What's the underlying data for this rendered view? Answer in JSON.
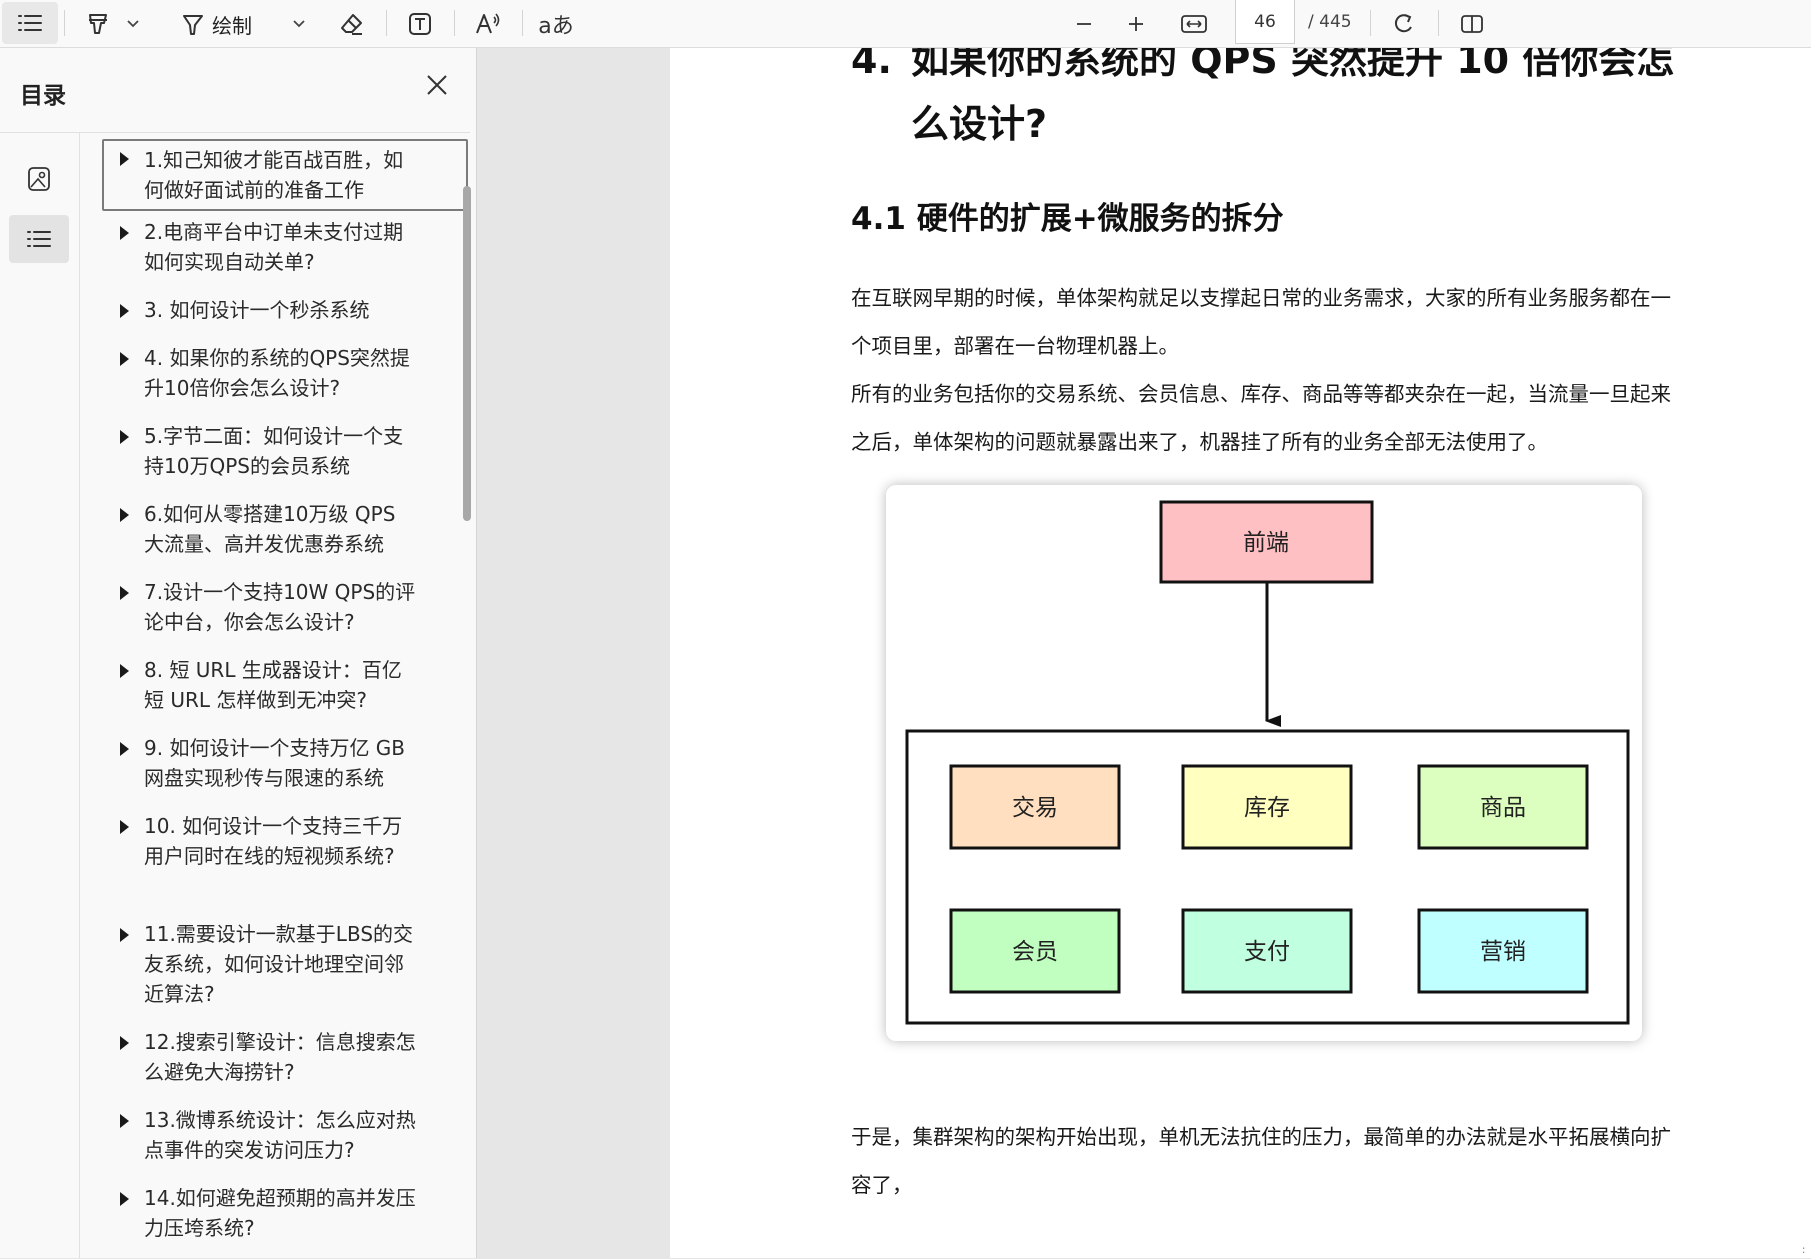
{
  "toolbar": {
    "draw_label": "绘制",
    "page_current": "46",
    "page_total": "/ 445"
  },
  "sidebar": {
    "title": "目录",
    "items": [
      "1.知己知彼才能百战百胜，如何做好面试前的准备工作",
      "2.电商平台中订单未支付过期如何实现自动关单?",
      "3. 如何设计一个秒杀系统",
      "4. 如果你的系统的QPS突然提升10倍你会怎么设计?",
      "5.字节二面：如何设计一个支持10万QPS的会员系统",
      "6.如何从零搭建10万级 QPS 大流量、高并发优惠券系统",
      "7.设计一个支持10W QPS的评论中台，你会怎么设计?",
      "8. 短 URL 生成器设计：百亿短 URL 怎样做到无冲突?",
      "9. 如何设计一个支持万亿 GB 网盘实现秒传与限速的系统",
      "10. 如何设计一个支持三千万用户同时在线的短视频系统?",
      "11.需要设计一款基于LBS的交友系统，如何设计地理空间邻近算法?",
      "12.搜索引擎设计：信息搜索怎么避免大海捞针?",
      "13.微博系统设计：怎么应对热点事件的突发访问压力?",
      "14.如何避免超预期的高并发压力压垮系统?"
    ]
  },
  "doc": {
    "h1_num": "4.",
    "h1_text": "如果你的系统的 QPS 突然提升 10 倍你会怎么设计?",
    "h2": "4.1  硬件的扩展+微服务的拆分",
    "para1": "在互联网早期的时候，单体架构就足以支撑起日常的业务需求，大家的所有业务服务都在一个项目里，部署在一台物理机器上。",
    "para2": "所有的业务包括你的交易系统、会员信息、库存、商品等等都夹杂在一起，当流量一旦起来之后，单体架构的问题就暴露出来了，机器挂了所有的业务全部无法使用了。",
    "para3": "于是，集群架构的架构开始出现，单机无法抗住的压力，最简单的办法就是水平拓展横向扩容了，"
  },
  "diagram": {
    "top": {
      "label": "前端",
      "color": "#ffc0c4"
    },
    "modules": [
      {
        "label": "交易",
        "color": "#ffdfbf"
      },
      {
        "label": "库存",
        "color": "#ffffc0"
      },
      {
        "label": "商品",
        "color": "#dcffbf"
      },
      {
        "label": "会员",
        "color": "#c1ffc1"
      },
      {
        "label": "支付",
        "color": "#c0ffe0"
      },
      {
        "label": "营销",
        "color": "#c0ffff"
      }
    ]
  }
}
